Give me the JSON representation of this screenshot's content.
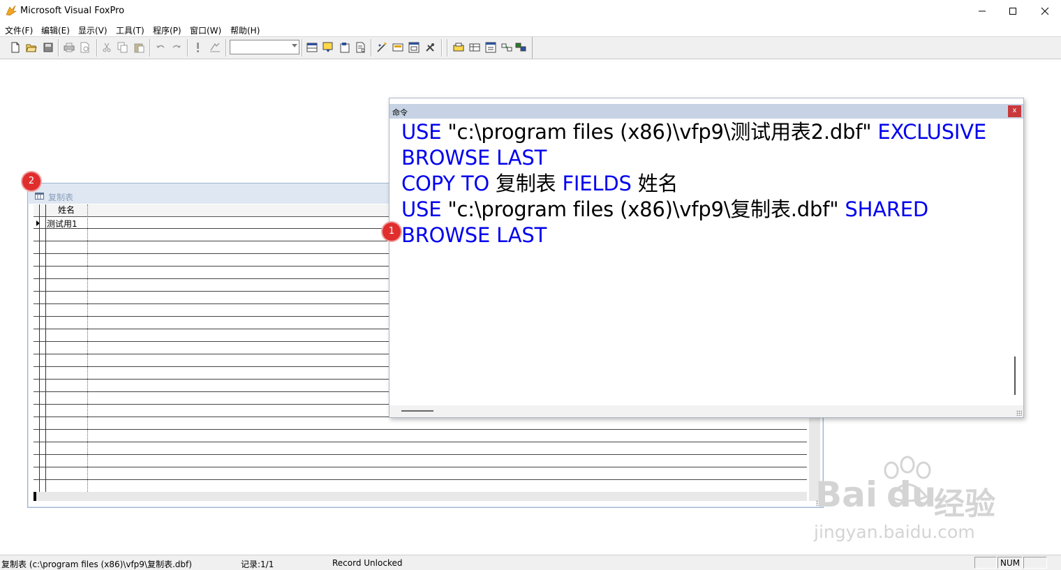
{
  "app": {
    "title": "Microsoft Visual FoxPro"
  },
  "window_controls": {
    "minimize": "minimize",
    "maximize": "maximize",
    "close": "close"
  },
  "menu": {
    "items": [
      {
        "label": "文件(F)"
      },
      {
        "label": "编辑(E)"
      },
      {
        "label": "显示(V)"
      },
      {
        "label": "工具(T)"
      },
      {
        "label": "程序(P)"
      },
      {
        "label": "窗口(W)"
      },
      {
        "label": "帮助(H)"
      }
    ]
  },
  "toolbar": {
    "combo_value": "",
    "icons": [
      "new-file-icon",
      "open-folder-icon",
      "save-icon",
      "print-icon",
      "print-preview-icon",
      "cut-icon",
      "copy-icon",
      "paste-icon",
      "undo-icon",
      "redo-icon",
      "run-icon",
      "modify-form-icon",
      "database-icon",
      "form-icon",
      "report-icon",
      "query-icon",
      "wizard-icon",
      "builder-icon",
      "form-designer-icon",
      "tools-icon",
      "view-icon",
      "table-icon",
      "data-session-icon",
      "class-browser-icon"
    ]
  },
  "browse_window": {
    "title": "复制表",
    "column_header": "姓名",
    "rows": [
      "测试用1"
    ]
  },
  "command_window": {
    "title": "命令",
    "close_label": "x",
    "lines": [
      {
        "k1": "USE",
        "t1": " \"c:\\program files (x86)\\vfp9\\测试用表2.dbf\" ",
        "k2": "EXCLUSIVE",
        "t2": ""
      },
      {
        "k1": "BROWSE LAST",
        "t1": "",
        "k2": "",
        "t2": ""
      },
      {
        "k1": "COPY TO",
        "t1": "  复制表 ",
        "k2": "FIELDS",
        "t2": "  姓名"
      },
      {
        "k1": "USE",
        "t1": " \"c:\\program files (x86)\\vfp9\\复制表.dbf\" ",
        "k2": "SHARED",
        "t2": ""
      },
      {
        "k1": "BROWSE LAST",
        "t1": "",
        "k2": "",
        "t2": ""
      }
    ]
  },
  "markers": {
    "m1": "1",
    "m2": "2"
  },
  "watermark": {
    "brand": "Bai",
    "brand2": "du",
    "brand_cn": "经验",
    "url": "jingyan.baidu.com"
  },
  "statusbar": {
    "path": "复制表 (c:\\program files (x86)\\vfp9\\复制表.dbf)",
    "record": "记录:1/1",
    "lock": "Record Unlocked",
    "num": "NUM"
  },
  "colors": {
    "keyword": "#0000ee",
    "marker": "#e02e2e"
  }
}
